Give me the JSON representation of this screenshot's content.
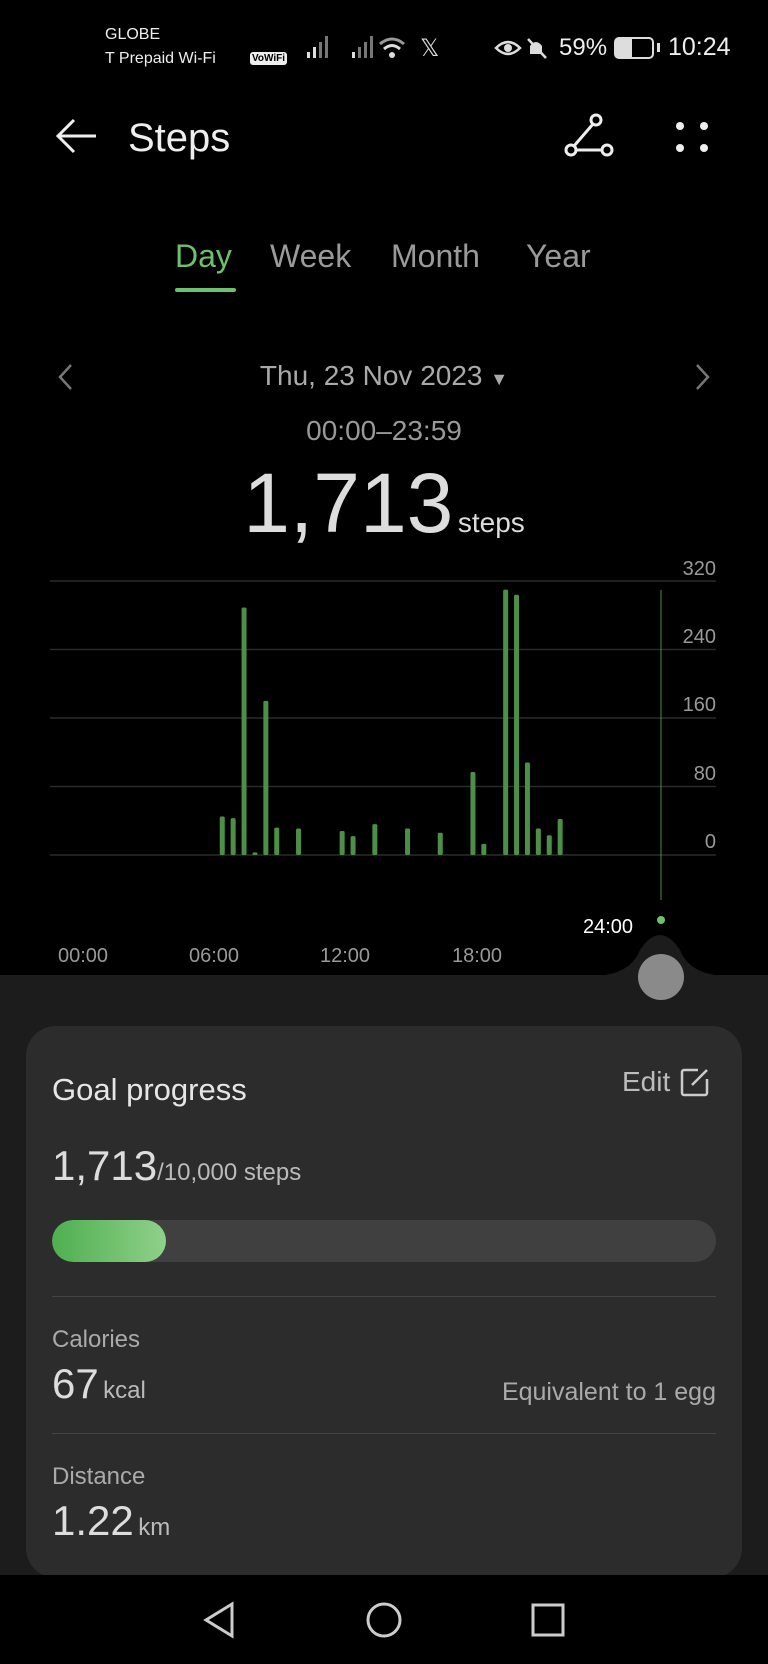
{
  "status_bar": {
    "carrier": "GLOBE",
    "network": "T Prepaid Wi-Fi",
    "vowifi": "VoWiFi",
    "battery": "59%",
    "time": "10:24"
  },
  "header": {
    "title": "Steps"
  },
  "tabs": [
    {
      "label": "Day",
      "active": true
    },
    {
      "label": "Week"
    },
    {
      "label": "Month"
    },
    {
      "label": "Year"
    }
  ],
  "date": {
    "label": "Thu, 23 Nov 2023",
    "range": "00:00–23:59"
  },
  "total": {
    "value": "1,713",
    "unit": "steps"
  },
  "colors": {
    "accent": "#6cc26c",
    "bar": "#4e8f48"
  },
  "chart_data": {
    "type": "bar",
    "x_ticks": [
      "00:00",
      "06:00",
      "12:00",
      "18:00"
    ],
    "cursor_label": "24:00",
    "y_ticks": [
      "320",
      "240",
      "160",
      "80",
      "0"
    ],
    "ylim": [
      0,
      320
    ],
    "grid": true,
    "x": [
      "07:30",
      "08:00",
      "08:30",
      "09:00",
      "09:30",
      "10:00",
      "11:00",
      "13:00",
      "13:30",
      "14:30",
      "16:00",
      "17:30",
      "19:00",
      "19:30",
      "20:30",
      "21:00",
      "21:30",
      "22:00",
      "22:30",
      "23:00"
    ],
    "values": [
      45,
      43,
      289,
      3,
      180,
      32,
      31,
      28,
      22,
      36,
      31,
      26,
      97,
      13,
      310,
      304,
      108,
      31,
      23,
      42
    ]
  },
  "goal": {
    "title": "Goal progress",
    "edit": "Edit",
    "current": "1,713",
    "target": "/10,000 steps",
    "progress": 0.1713
  },
  "calories": {
    "label": "Calories",
    "value": "67",
    "unit": "kcal",
    "equivalent": "Equivalent to 1 egg"
  },
  "distance": {
    "label": "Distance",
    "value": "1.22",
    "unit": "km"
  }
}
